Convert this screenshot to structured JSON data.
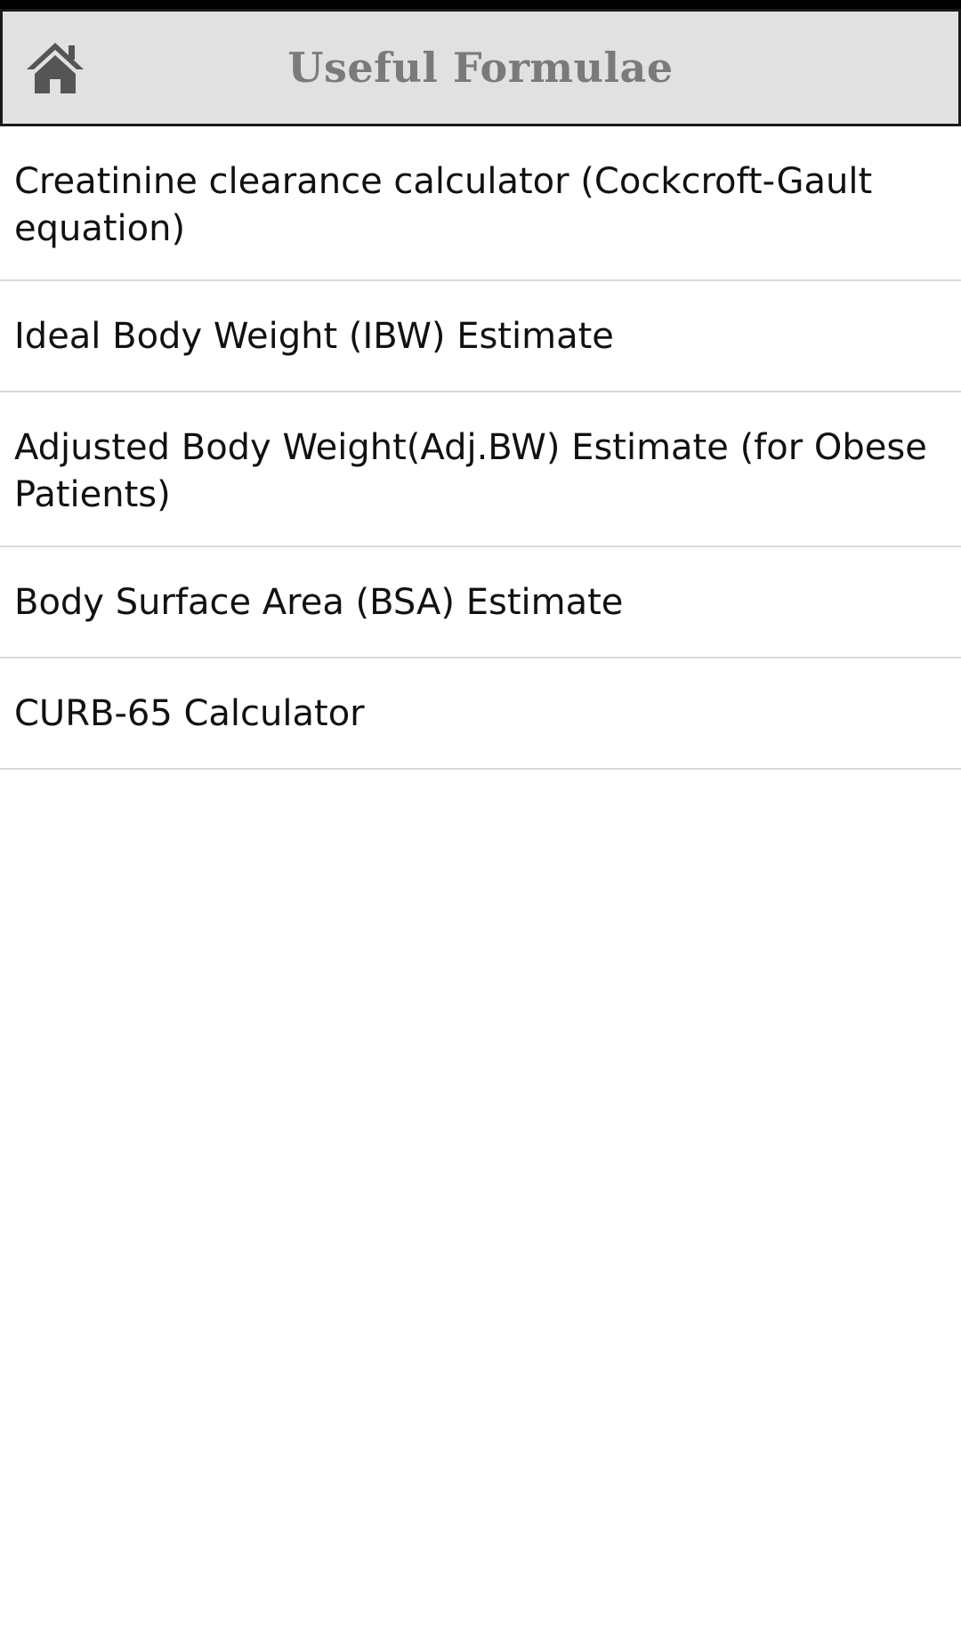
{
  "header": {
    "title": "Useful Formulae",
    "home_icon": "home-icon"
  },
  "colors": {
    "header_background": "#e1e1e1",
    "header_title": "#7a7a7a",
    "divider": "#d9d9d9",
    "text": "#111111"
  },
  "menu": {
    "items": [
      {
        "label": "Creatinine clearance calculator (Cockcroft-Gault equation)"
      },
      {
        "label": "Ideal Body Weight (IBW) Estimate"
      },
      {
        "label": "Adjusted Body Weight(Adj.BW) Estimate (for Obese Patients)"
      },
      {
        "label": "Body Surface Area (BSA) Estimate"
      },
      {
        "label": "CURB-65 Calculator"
      }
    ]
  }
}
